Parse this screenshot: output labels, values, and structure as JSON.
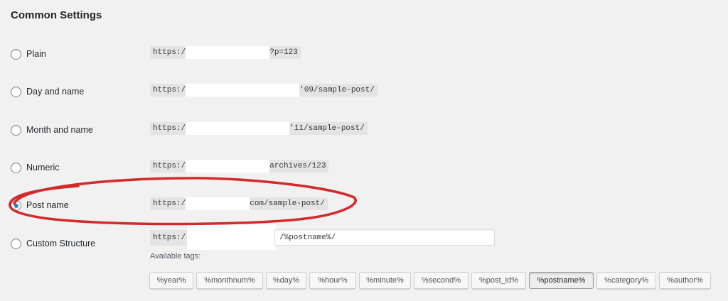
{
  "section": {
    "title": "Common Settings"
  },
  "options": [
    {
      "label": "Plain",
      "prefix": "https:/",
      "suffix": "?p=123",
      "checked": false
    },
    {
      "label": "Day and name",
      "prefix": "https:/",
      "suffix": "'09/sample-post/",
      "checked": false
    },
    {
      "label": "Month and name",
      "prefix": "https:/",
      "suffix": "'11/sample-post/",
      "checked": false
    },
    {
      "label": "Numeric",
      "prefix": "https:/",
      "suffix": "archives/123",
      "checked": false
    },
    {
      "label": "Post name",
      "prefix": "https:/",
      "suffix": "com/sample-post/",
      "checked": true
    }
  ],
  "custom": {
    "label": "Custom Structure",
    "prefix": "https:/",
    "value": "/%postname%/",
    "available_tags_label": "Available tags:"
  },
  "tags": [
    "%year%",
    "%monthnum%",
    "%day%",
    "%hour%",
    "%minute%",
    "%second%",
    "%post_id%",
    "%postname%",
    "%category%",
    "%author%"
  ],
  "active_tag": "%postname%",
  "colors": {
    "background": "#f1f1f1",
    "radio_checked": "#1e8cbe",
    "annotation_ellipse": "#d42a2a",
    "code_bg": "#e4e4e4"
  }
}
